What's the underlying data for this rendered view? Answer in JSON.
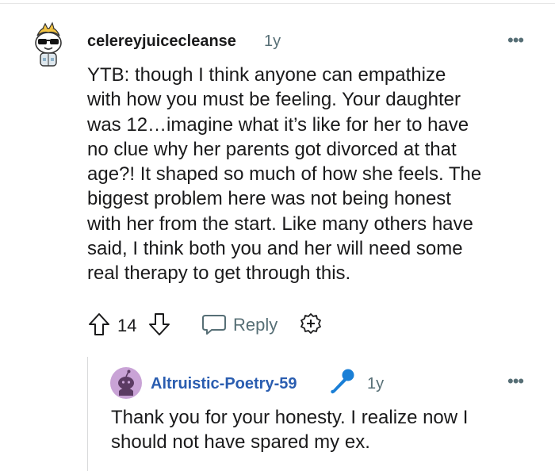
{
  "comment": {
    "username": "celereyjuicecleanse",
    "time": "1y",
    "more_label": "•••",
    "avatar_icon": "snoo-sunglasses-avatar",
    "body_lines": [
      "YTB: though I think anyone can empathize",
      "with how you must be feeling. Your daughter",
      "was 12…imagine what it’s like for her to have",
      "no clue why her parents got divorced at that",
      "age?! It shaped so much of how she feels. The",
      "biggest problem here was not being honest",
      "with her from the start. Like many others have",
      "said, I think both you and her will need some",
      "real therapy to get through this."
    ],
    "score": "14",
    "reply_label": "Reply",
    "icons": [
      "upvote-icon",
      "downvote-icon",
      "reply-icon",
      "award-icon"
    ]
  },
  "reply": {
    "username": "Altruistic-Poetry-59",
    "time": "1y",
    "more_label": "•••",
    "avatar_icon": "snoo-purple-avatar",
    "badge_icon": "microphone-icon",
    "body_lines": [
      "Thank you for your honesty. I realize now I",
      "should not have spared my ex."
    ]
  },
  "colors": {
    "username_link": "#2a5db0",
    "meta_gray": "#576f76",
    "text": "#1a1a1b",
    "mic_blue": "#1a7fd6",
    "avatar_purple": "#c9a3d6"
  }
}
